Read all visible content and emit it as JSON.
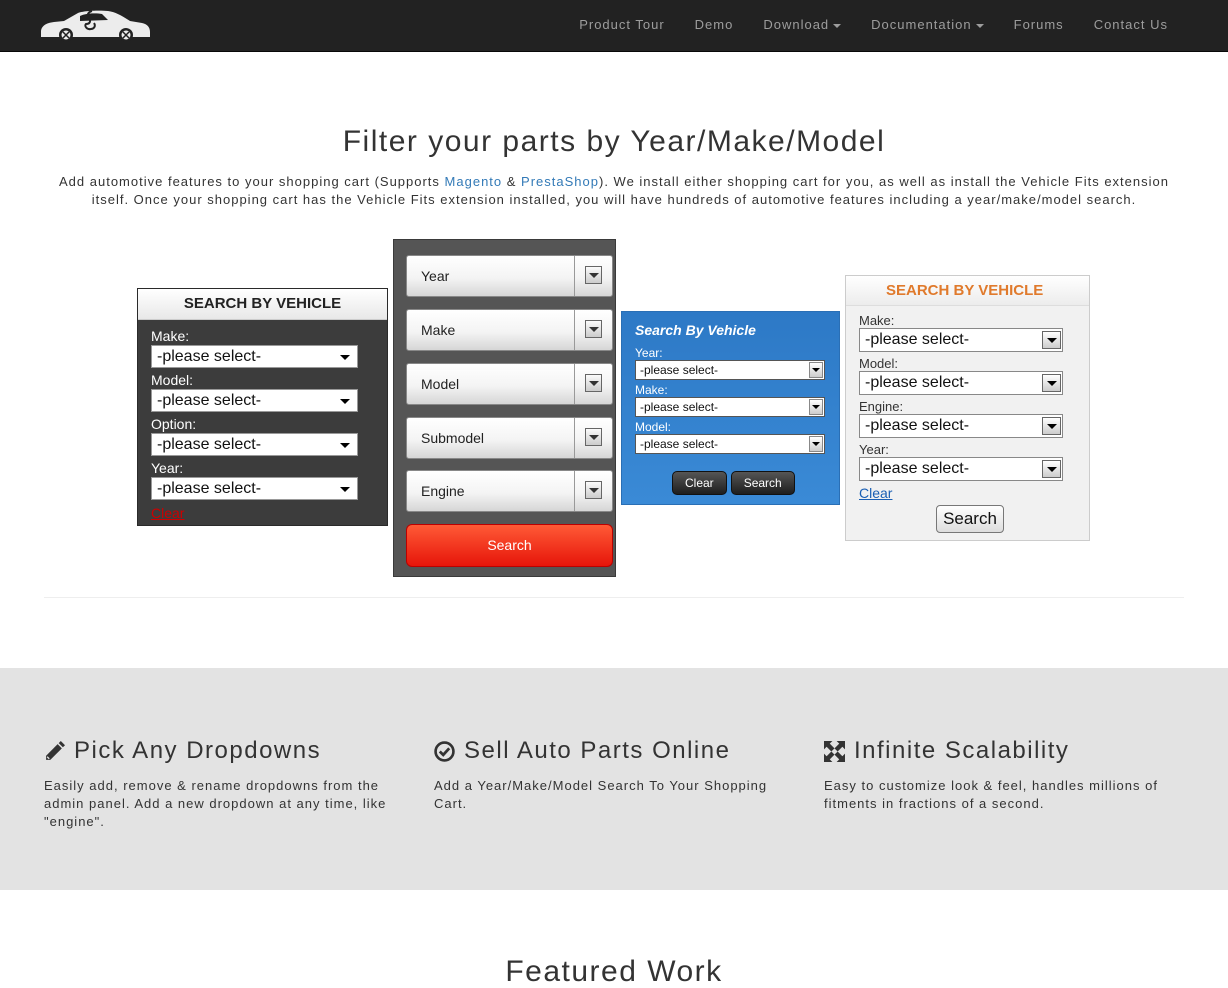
{
  "nav": {
    "items": [
      {
        "label": "Product Tour",
        "dropdown": false
      },
      {
        "label": "Demo",
        "dropdown": false
      },
      {
        "label": "Download",
        "dropdown": true
      },
      {
        "label": "Documentation",
        "dropdown": true
      },
      {
        "label": "Forums",
        "dropdown": false
      },
      {
        "label": "Contact Us",
        "dropdown": false
      }
    ]
  },
  "hero": {
    "title": "Filter your parts by Year/Make/Model",
    "text_before": "Add automotive features to your shopping cart (Supports ",
    "link_magento": "Magento",
    "amp": " & ",
    "link_prestashop": "PrestaShop",
    "text_after": "). We install either shopping cart for you, as well as install the Vehicle Fits extension itself. Once your shopping cart has the Vehicle Fits extension installed, you will have hundreds of automotive features including a year/make/model search."
  },
  "widget1": {
    "title": "SEARCH BY VEHICLE",
    "fields": [
      {
        "label": "Make:",
        "value": "-please select-"
      },
      {
        "label": "Model:",
        "value": "-please select-"
      },
      {
        "label": "Option:",
        "value": "-please select-"
      },
      {
        "label": "Year:",
        "value": "-please select-"
      }
    ],
    "clear": "Clear"
  },
  "widget2": {
    "fields": [
      "Year",
      "Make",
      "Model",
      "Submodel",
      "Engine"
    ],
    "search": "Search"
  },
  "widget3": {
    "title": "Search By Vehicle",
    "fields": [
      {
        "label": "Year:",
        "value": "-please select-"
      },
      {
        "label": "Make:",
        "value": "-please select-"
      },
      {
        "label": "Model:",
        "value": "-please select-"
      }
    ],
    "clear": "Clear",
    "search": "Search"
  },
  "widget4": {
    "title": "SEARCH BY VEHICLE",
    "fields": [
      {
        "label": "Make:",
        "value": "-please select-"
      },
      {
        "label": "Model:",
        "value": "-please select-"
      },
      {
        "label": "Engine:",
        "value": "-please select-"
      },
      {
        "label": "Year:",
        "value": "-please select-"
      }
    ],
    "clear": "Clear",
    "search": "Search"
  },
  "features": [
    {
      "icon": "pencil-icon",
      "title": "Pick Any Dropdowns",
      "text": "Easily add, remove & rename dropdowns from the admin panel. Add a new dropdown at any time, like \"engine\"."
    },
    {
      "icon": "check-circle-icon",
      "title": "Sell Auto Parts Online",
      "text": "Add a Year/Make/Model Search To Your Shopping Cart."
    },
    {
      "icon": "expand-arrows-icon",
      "title": "Infinite Scalability",
      "text": "Easy to customize look & feel, handles millions of fitments in fractions of a second."
    }
  ],
  "featured_title": "Featured Work",
  "colors": {
    "navbar": "#222222",
    "link": "#337ab7",
    "features_bg": "#e3e3e3",
    "search_red": "#e6150a",
    "widget3_blue": "#2d79c6",
    "widget4_orange": "#e07a2c"
  }
}
